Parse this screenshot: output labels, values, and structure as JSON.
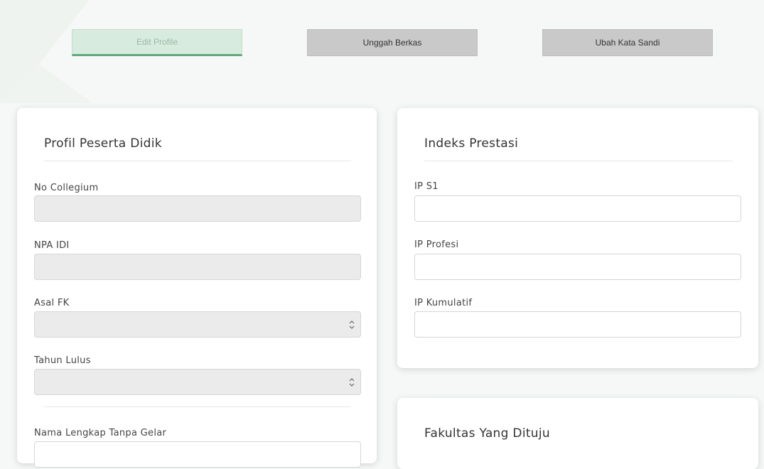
{
  "tabs": [
    {
      "label": "Edit Profile",
      "state": "active"
    },
    {
      "label": "Unggah Berkas",
      "state": "inactive"
    },
    {
      "label": "Ubah Kata Sandi",
      "state": "inactive"
    }
  ],
  "profile_card": {
    "title": "Profil Peserta Didik",
    "fields": {
      "no_collegium": {
        "label": "No Collegium",
        "value": ""
      },
      "npa_idi": {
        "label": "NPA IDI",
        "value": ""
      },
      "asal_fk": {
        "label": "Asal FK",
        "value": ""
      },
      "tahun_lulus": {
        "label": "Tahun Lulus",
        "value": ""
      },
      "nama_lengkap": {
        "label": "Nama Lengkap Tanpa Gelar",
        "value": ""
      }
    }
  },
  "ip_card": {
    "title": "Indeks Prestasi",
    "fields": {
      "ip_s1": {
        "label": "IP S1",
        "value": ""
      },
      "ip_profesi": {
        "label": "IP Profesi",
        "value": ""
      },
      "ip_kumulatif": {
        "label": "IP Kumulatif",
        "value": ""
      }
    }
  },
  "faculty_card": {
    "title": "Fakultas Yang Dituju"
  },
  "colors": {
    "accent": "#5fab7c",
    "active_tab_bg": "#d8ebdf",
    "inactive_tab_bg": "#c9c9c9",
    "disabled_field_bg": "#ebebeb",
    "page_bg": "#f5f8f6"
  },
  "icons": {
    "select_indicator": "up-down-chevron-icon"
  }
}
